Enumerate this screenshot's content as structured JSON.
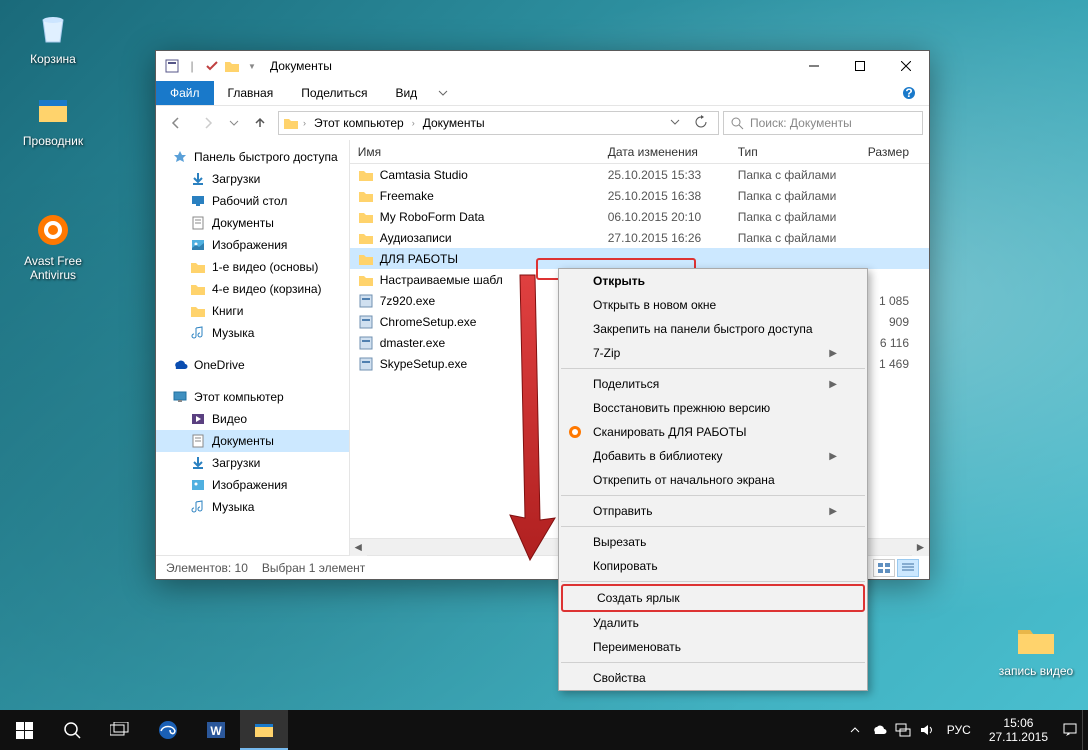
{
  "desktop": {
    "recycle": "Корзина",
    "explorer": "Проводник",
    "avast": "Avast Free Antivirus",
    "rec_video": "запись видео"
  },
  "window": {
    "title": "Документы",
    "tabs": {
      "file": "Файл",
      "home": "Главная",
      "share": "Поделиться",
      "view": "Вид"
    },
    "breadcrumb": {
      "pc": "Этот компьютер",
      "docs": "Документы"
    },
    "search_placeholder": "Поиск: Документы",
    "nav": {
      "quick": "Панель быстрого доступа",
      "downloads": "Загрузки",
      "desktop": "Рабочий стол",
      "docs": "Документы",
      "pics": "Изображения",
      "v1": "1-е видео (основы)",
      "v4": "4-е видео (корзина)",
      "books": "Книги",
      "music": "Музыка",
      "onedrive": "OneDrive",
      "thispc": "Этот компьютер",
      "video": "Видео",
      "docs2": "Документы",
      "dl2": "Загрузки",
      "pics2": "Изображения",
      "music2": "Музыка"
    },
    "cols": {
      "name": "Имя",
      "date": "Дата изменения",
      "type": "Тип",
      "size": "Размер"
    },
    "files": [
      {
        "n": "Camtasia Studio",
        "d": "25.10.2015 15:33",
        "t": "Папка с файлами",
        "s": ""
      },
      {
        "n": "Freemake",
        "d": "25.10.2015 16:38",
        "t": "Папка с файлами",
        "s": ""
      },
      {
        "n": "My RoboForm Data",
        "d": "06.10.2015 20:10",
        "t": "Папка с файлами",
        "s": ""
      },
      {
        "n": "Аудиозаписи",
        "d": "27.10.2015 16:26",
        "t": "Папка с файлами",
        "s": ""
      },
      {
        "n": "ДЛЯ РАБОТЫ",
        "d": "",
        "t": "",
        "s": ""
      },
      {
        "n": "Настраиваемые шабл",
        "d": "",
        "t": "",
        "s": ""
      },
      {
        "n": "7z920.exe",
        "d": "",
        "t": "",
        "s": "1 085"
      },
      {
        "n": "ChromeSetup.exe",
        "d": "",
        "t": "",
        "s": "909"
      },
      {
        "n": "dmaster.exe",
        "d": "",
        "t": "",
        "s": "6 116"
      },
      {
        "n": "SkypeSetup.exe",
        "d": "",
        "t": "",
        "s": "1 469"
      }
    ],
    "status": {
      "count": "Элементов: 10",
      "sel": "Выбран 1 элемент"
    }
  },
  "ctx": [
    {
      "l": "Открыть",
      "b": true
    },
    {
      "l": "Открыть в новом окне"
    },
    {
      "l": "Закрепить на панели быстрого доступа"
    },
    {
      "l": "7-Zip",
      "sub": true
    },
    {
      "sep": true
    },
    {
      "l": "Поделиться",
      "sub": true
    },
    {
      "l": "Восстановить прежнюю версию"
    },
    {
      "l": "Сканировать ДЛЯ РАБОТЫ",
      "ico": "avast"
    },
    {
      "l": "Добавить в библиотеку",
      "sub": true
    },
    {
      "l": "Открепить от начального экрана"
    },
    {
      "sep": true
    },
    {
      "l": "Отправить",
      "sub": true
    },
    {
      "sep": true
    },
    {
      "l": "Вырезать"
    },
    {
      "l": "Копировать"
    },
    {
      "sep": true
    },
    {
      "l": "Создать ярлык",
      "hl": true
    },
    {
      "l": "Удалить"
    },
    {
      "l": "Переименовать"
    },
    {
      "sep": true
    },
    {
      "l": "Свойства"
    }
  ],
  "taskbar": {
    "lang": "РУС",
    "time": "15:06",
    "date": "27.11.2015"
  }
}
